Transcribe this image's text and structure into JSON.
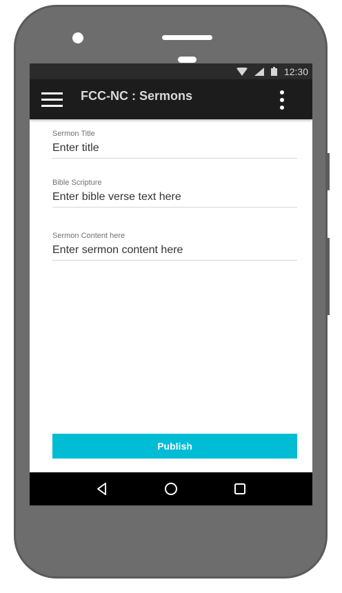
{
  "status_bar": {
    "time": "12:30",
    "icons": [
      "wifi-icon",
      "signal-icon",
      "battery-icon"
    ]
  },
  "app_bar": {
    "title": "FCC-NC : Sermons",
    "left_icon": "menu-icon",
    "right_icon": "more-vert-icon"
  },
  "form": {
    "fields": [
      {
        "label": "Sermon Title",
        "placeholder": "Enter title"
      },
      {
        "label": "Bible Scripture",
        "placeholder": "Enter bible verse text here"
      },
      {
        "label": "Sermon Content here",
        "placeholder": "Enter sermon content here"
      }
    ],
    "publish_label": "Publish"
  },
  "nav_bar": {
    "icons": [
      "back-icon",
      "home-icon",
      "recents-icon"
    ]
  },
  "colors": {
    "accent": "#00bcd4",
    "app_bar": "#1c1c1c",
    "status_bar": "#2b2b2b",
    "device_body": "#6d6d6d"
  }
}
